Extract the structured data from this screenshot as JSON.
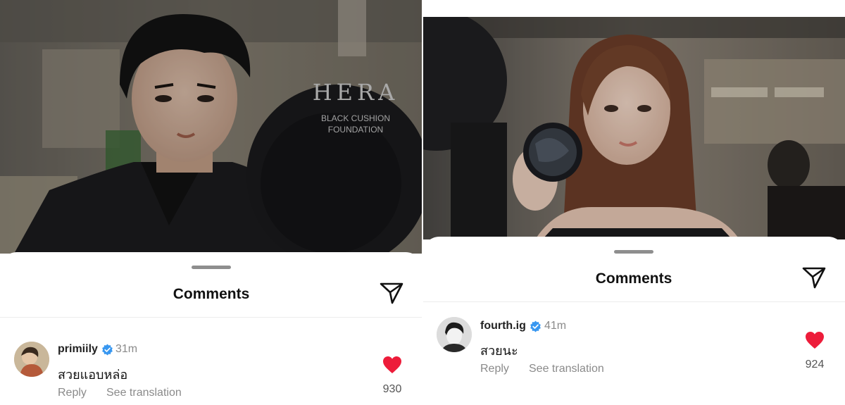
{
  "left": {
    "sheet_title": "Comments",
    "photo_sign": {
      "brand": "HERA",
      "sub_line1": "BLACK CUSHION",
      "sub_line2": "FOUNDATION"
    },
    "comment": {
      "username": "primiily",
      "time": "31m",
      "text": "สวยแอบหล่อ",
      "reply_label": "Reply",
      "translate_label": "See translation",
      "likes": "930"
    }
  },
  "right": {
    "sheet_title": "Comments",
    "comment": {
      "username": "fourth.ig",
      "time": "41m",
      "text": "สวยนะ",
      "reply_label": "Reply",
      "translate_label": "See translation",
      "likes": "924"
    }
  },
  "icons": {
    "send": "paper-plane-icon",
    "verified": "verified-badge-icon",
    "like": "heart-icon"
  },
  "colors": {
    "heart": "#ed1c3a",
    "verified": "#3897f0",
    "muted_text": "#8a8a8a"
  }
}
